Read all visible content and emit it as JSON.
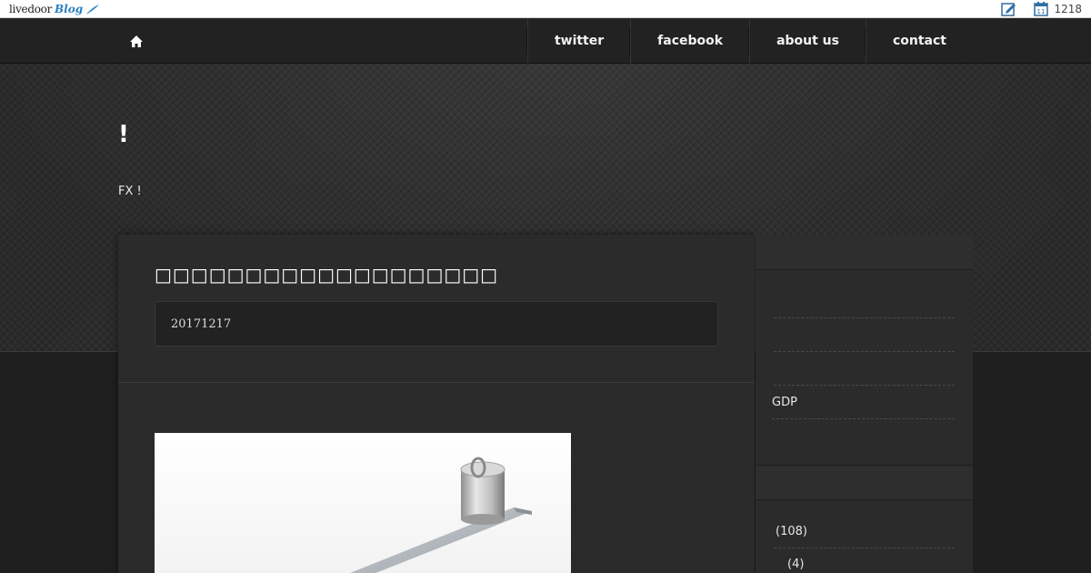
{
  "toolbar": {
    "logo_word": "livedoor",
    "logo_blog": "Blog",
    "visitor_count": "1218"
  },
  "nav": {
    "items": [
      {
        "label": "twitter"
      },
      {
        "label": "facebook"
      },
      {
        "label": "about us"
      },
      {
        "label": "contact"
      }
    ]
  },
  "header": {
    "title": "!",
    "description": "FX !"
  },
  "article": {
    "title": "□□□□□□□□□□□□□□□□□□□",
    "date": "20171217"
  },
  "sidebar": {
    "group1": [
      "",
      "",
      "",
      "GDP"
    ],
    "group2": [
      "(108)",
      "(4)"
    ]
  }
}
